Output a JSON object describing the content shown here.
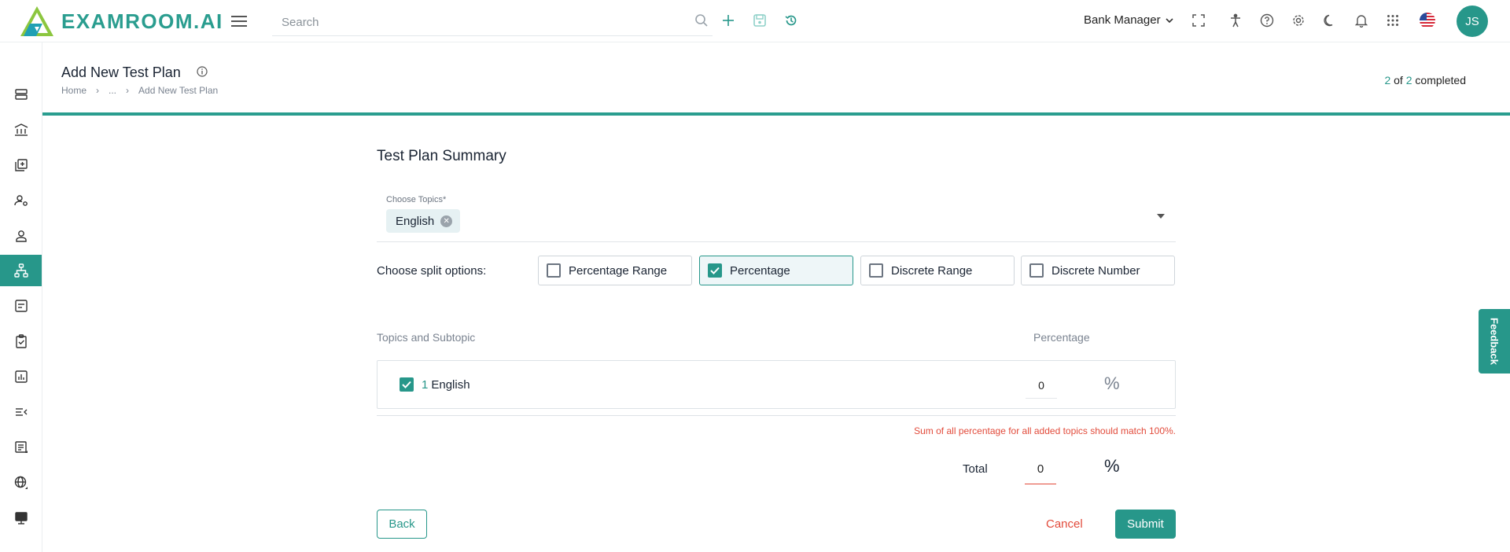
{
  "app": {
    "logo_text": "EXAMROOM.AI"
  },
  "search": {
    "placeholder": "Search"
  },
  "header": {
    "role_label": "Bank Manager",
    "avatar_initials": "JS"
  },
  "page": {
    "title": "Add New Test Plan",
    "breadcrumb": [
      "Home",
      "...",
      "Add New Test Plan"
    ],
    "progress": {
      "current": "2",
      "of_label": "of",
      "total": "2",
      "status": "completed"
    }
  },
  "form": {
    "section_title": "Test Plan Summary",
    "topics_label": "Choose Topics*",
    "selected_topic": "English",
    "split_label": "Choose split options:",
    "split_options": [
      {
        "label": "Percentage Range",
        "checked": false
      },
      {
        "label": "Percentage",
        "checked": true
      },
      {
        "label": "Discrete Range",
        "checked": false
      },
      {
        "label": "Discrete Number",
        "checked": false
      }
    ],
    "table": {
      "col_topics": "Topics and Subtopic",
      "col_percentage": "Percentage",
      "rows": [
        {
          "index": "1",
          "name": "English",
          "value": "0",
          "unit": "%",
          "checked": true
        }
      ]
    },
    "error_message": "Sum of all percentage for all added topics should match 100%.",
    "total_label": "Total",
    "total_value": "0",
    "total_unit": "%",
    "buttons": {
      "back": "Back",
      "cancel": "Cancel",
      "submit": "Submit"
    }
  },
  "feedback_label": "Feedback",
  "colors": {
    "accent": "#27978a",
    "error": "#e24b3b"
  }
}
